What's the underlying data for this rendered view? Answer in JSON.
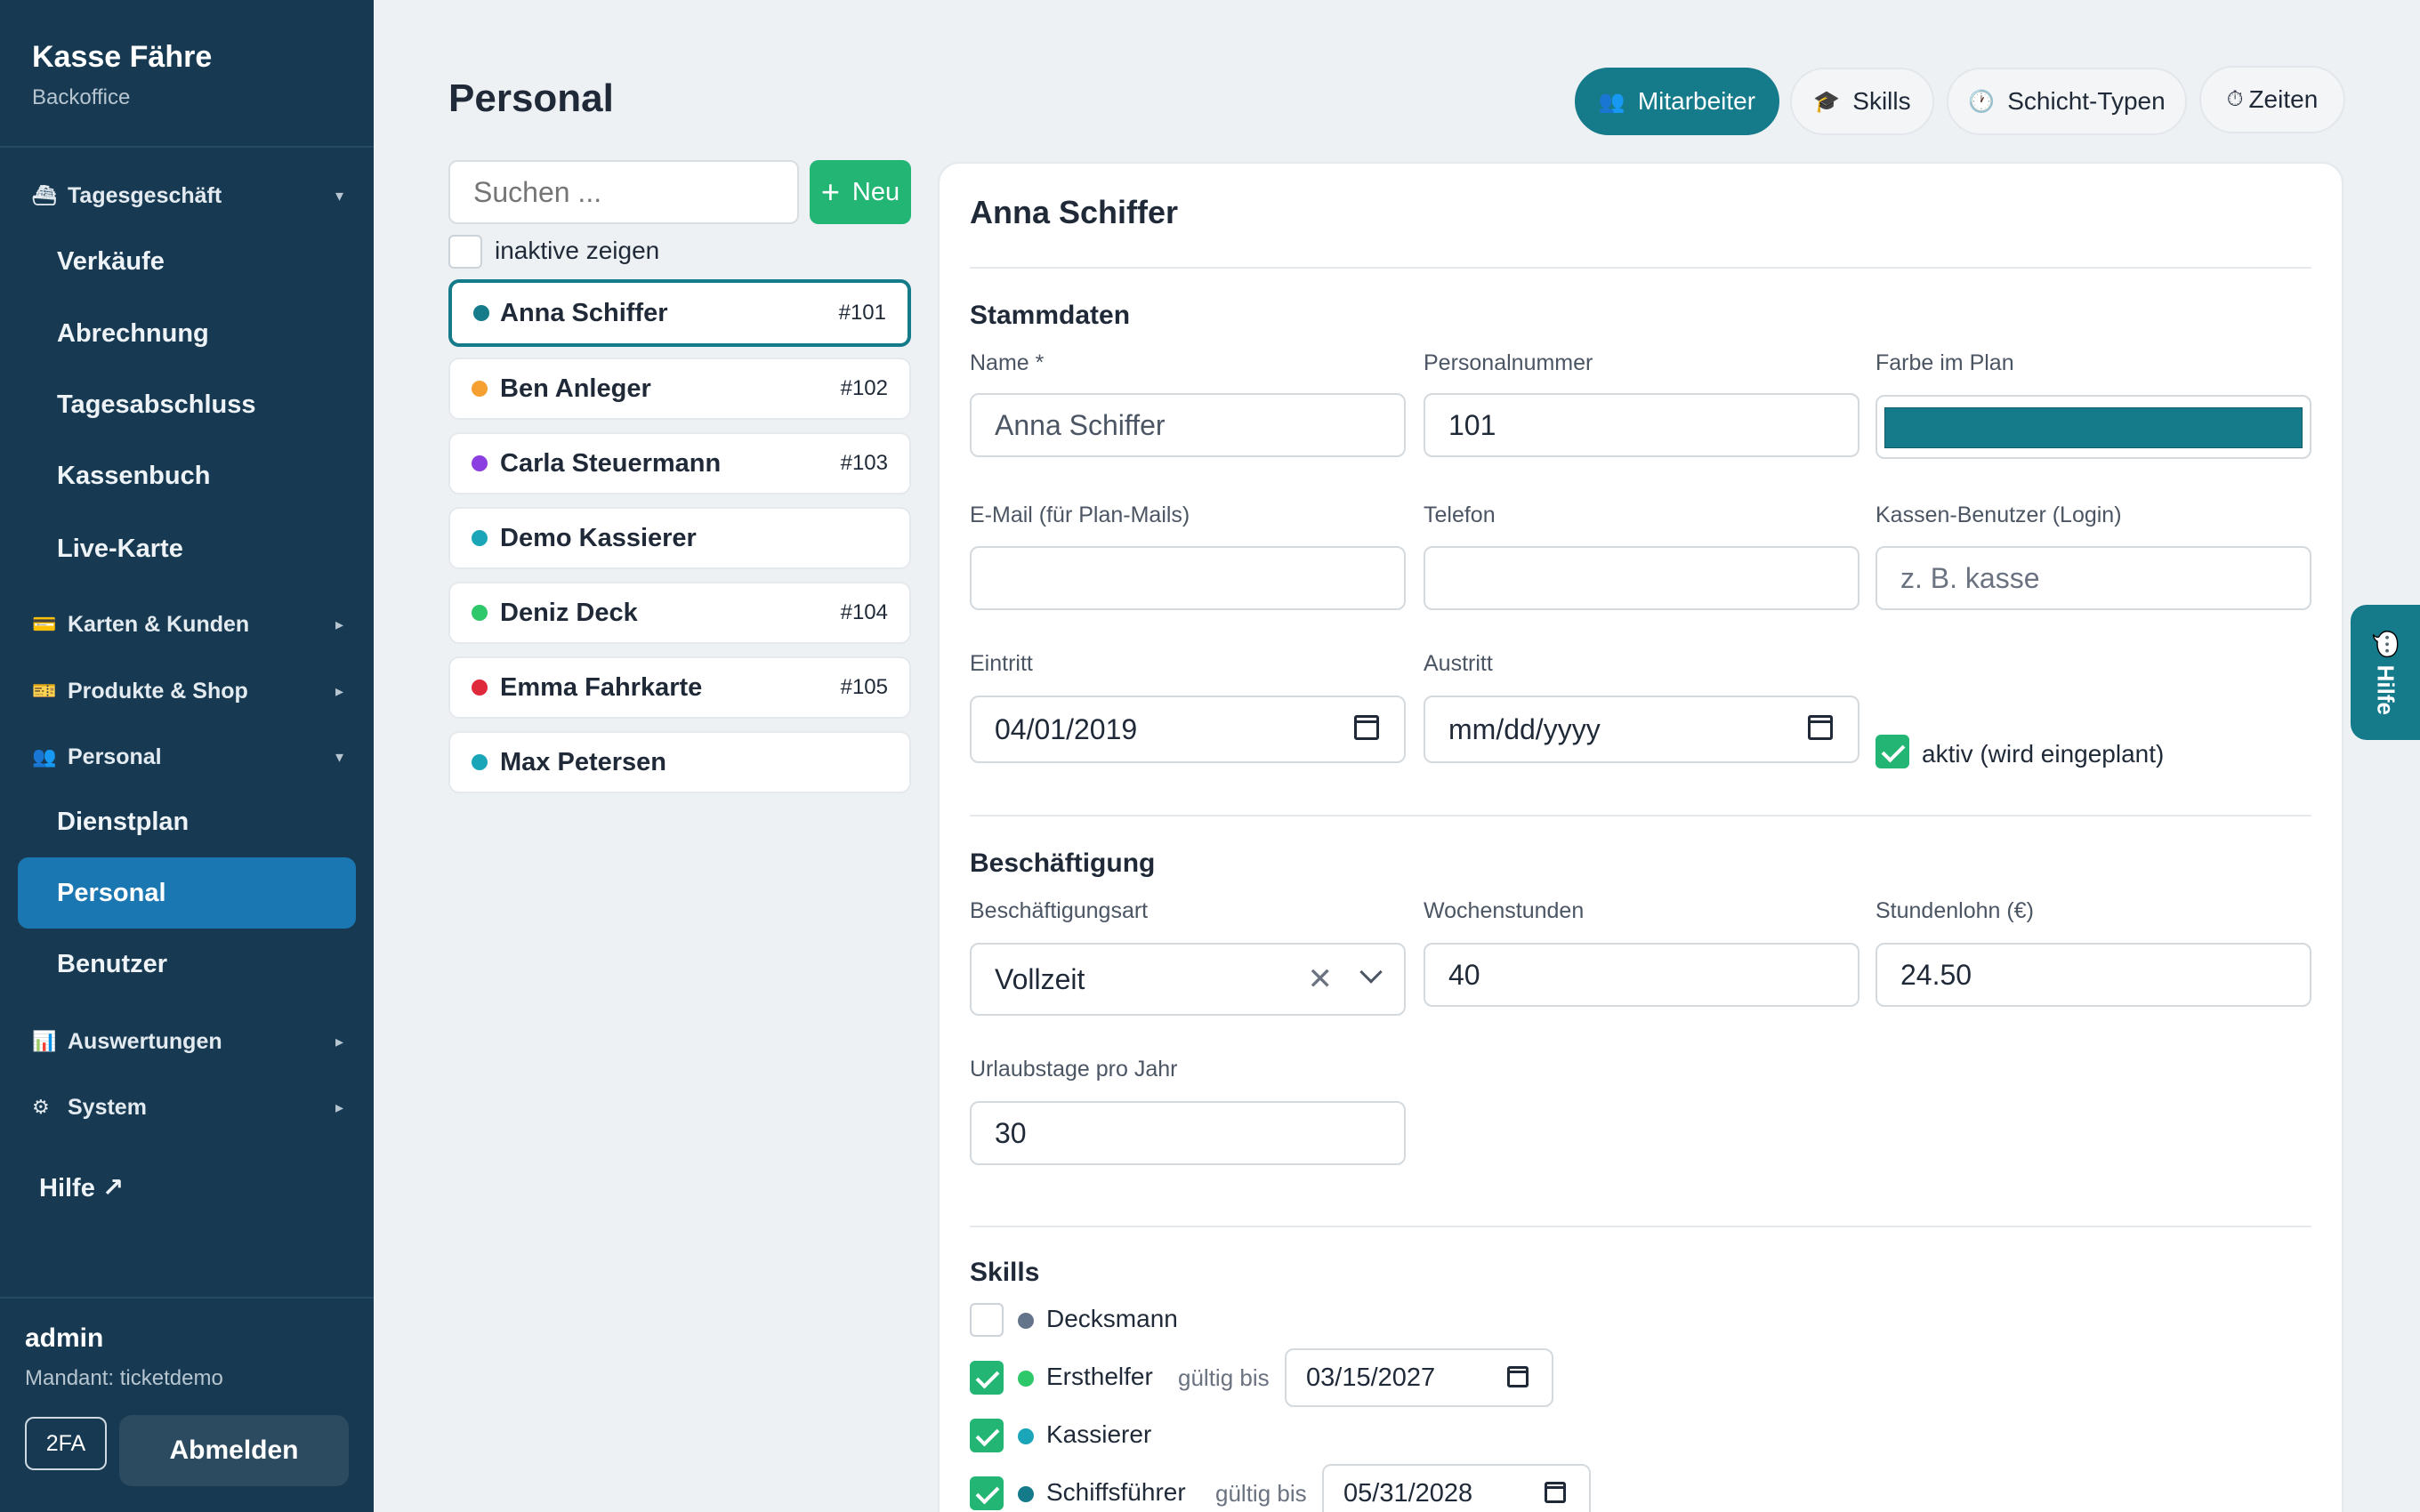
{
  "app": {
    "title": "Kasse Fähre",
    "subtitle": "Backoffice"
  },
  "sidebar": {
    "sections": [
      {
        "icon": "ship-icon",
        "glyph": "⛴",
        "label": "Tagesgeschäft",
        "expanded": true
      },
      {
        "icon": "card-icon",
        "glyph": "💳",
        "label": "Karten & Kunden",
        "expanded": false
      },
      {
        "icon": "shop-icon",
        "glyph": "🎫",
        "label": "Produkte & Shop",
        "expanded": false
      },
      {
        "icon": "people-icon",
        "glyph": "👥",
        "label": "Personal",
        "expanded": true
      },
      {
        "icon": "chart-icon",
        "glyph": "📊",
        "label": "Auswertungen",
        "expanded": false
      },
      {
        "icon": "gear-icon",
        "glyph": "⚙",
        "label": "System",
        "expanded": false
      }
    ],
    "tagesgeschaeft_items": [
      "Verkäufe",
      "Abrechnung",
      "Tagesabschluss",
      "Kassenbuch",
      "Live-Karte"
    ],
    "personal_items": [
      "Dienstplan",
      "Personal",
      "Benutzer"
    ],
    "active_item": "Personal",
    "help_label": "Hilfe ↗",
    "user": {
      "name": "admin",
      "tenant": "Mandant: ticketdemo"
    },
    "btn_2fa": "2FA",
    "btn_logout": "Abmelden"
  },
  "header": {
    "title": "Personal",
    "tabs": [
      {
        "label": "Mitarbeiter",
        "glyph": "👥",
        "active": true
      },
      {
        "label": "Skills",
        "glyph": "🎓",
        "active": false
      },
      {
        "label": "Schicht-Typen",
        "glyph": "🕐",
        "active": false
      },
      {
        "label": "Zeiten",
        "glyph": "⏱",
        "active": false
      }
    ]
  },
  "list": {
    "search_placeholder": "Suchen ...",
    "new_label": "Neu",
    "new_glyph": "+",
    "inactive_label": "inaktive zeigen",
    "inactive_checked": false,
    "employees": [
      {
        "name": "Anna Schiffer",
        "number": "#101",
        "color": "#157a8a",
        "selected": true
      },
      {
        "name": "Ben Anleger",
        "number": "#102",
        "color": "#f5a030",
        "selected": false
      },
      {
        "name": "Carla Steuermann",
        "number": "#103",
        "color": "#8b3fe0",
        "selected": false
      },
      {
        "name": "Demo Kassierer",
        "number": "",
        "color": "#1aa6b8",
        "selected": false
      },
      {
        "name": "Deniz Deck",
        "number": "#104",
        "color": "#2ec76a",
        "selected": false
      },
      {
        "name": "Emma Fahrkarte",
        "number": "#105",
        "color": "#e0283c",
        "selected": false
      },
      {
        "name": "Max Petersen",
        "number": "",
        "color": "#1aa6b8",
        "selected": false
      }
    ]
  },
  "detail": {
    "title": "Anna Schiffer",
    "stammdaten": {
      "heading": "Stammdaten",
      "name_label": "Name *",
      "name_value": "Anna Schiffer",
      "persnr_label": "Personalnummer",
      "persnr_value": "101",
      "farbe_label": "Farbe im Plan",
      "farbe_value": "#157a8a",
      "email_label": "E-Mail (für Plan-Mails)",
      "email_value": "",
      "telefon_label": "Telefon",
      "telefon_value": "",
      "login_label": "Kassen-Benutzer (Login)",
      "login_placeholder": "z. B. kasse",
      "eintritt_label": "Eintritt",
      "eintritt_value": "04/01/2019",
      "austritt_label": "Austritt",
      "austritt_placeholder": "mm/dd/yyyy",
      "aktiv_label": "aktiv (wird eingeplant)",
      "aktiv_checked": true
    },
    "beschaeftigung": {
      "heading": "Beschäftigung",
      "art_label": "Beschäftigungsart",
      "art_value": "Vollzeit",
      "stunden_label": "Wochenstunden",
      "stunden_value": "40",
      "lohn_label": "Stundenlohn (€)",
      "lohn_value": "24.50",
      "urlaub_label": "Urlaubstage pro Jahr",
      "urlaub_value": "30"
    },
    "skills": {
      "heading": "Skills",
      "valid_label": "gültig bis",
      "items": [
        {
          "name": "Decksmann",
          "checked": false,
          "color": "#64748b",
          "valid_until": ""
        },
        {
          "name": "Ersthelfer",
          "checked": true,
          "color": "#2ec76a",
          "valid_until": "03/15/2027"
        },
        {
          "name": "Kassierer",
          "checked": true,
          "color": "#1aa6b8",
          "valid_until": ""
        },
        {
          "name": "Schiffsführer",
          "checked": true,
          "color": "#157a8a",
          "valid_until": "05/31/2028"
        }
      ]
    }
  },
  "help_tab": {
    "label": "💬 Hilfe"
  }
}
